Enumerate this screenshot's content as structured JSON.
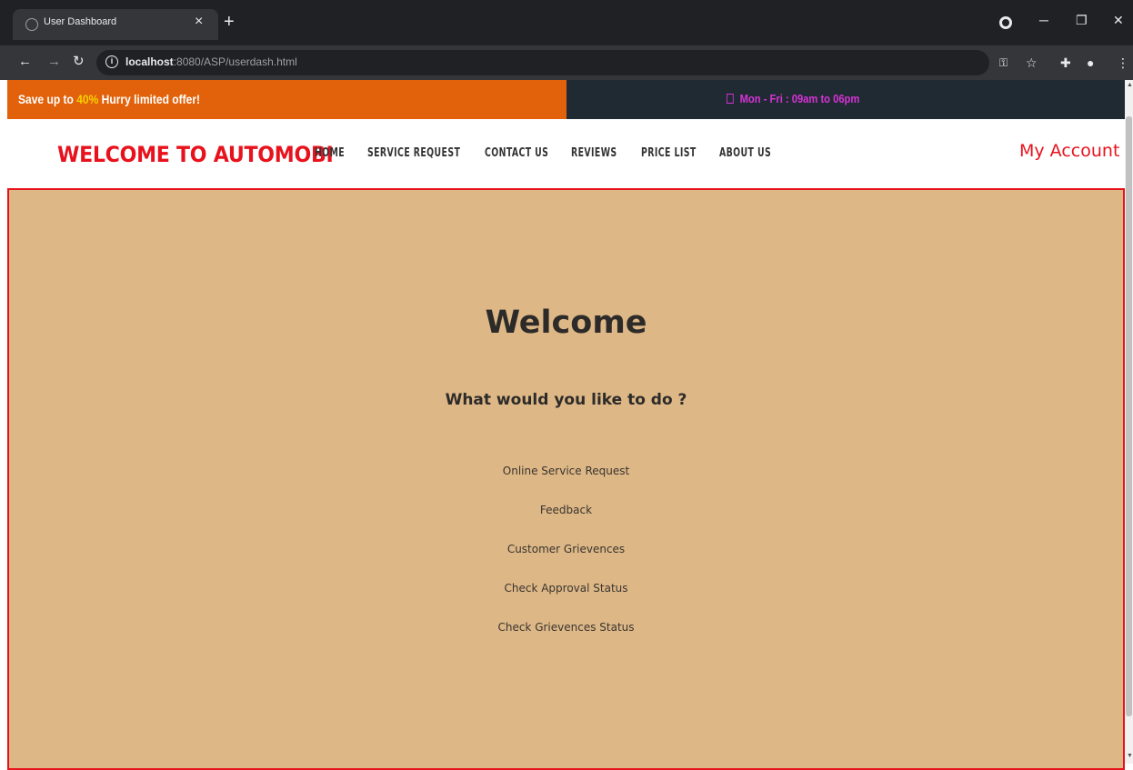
{
  "browser": {
    "tab_title": "User Dashboard",
    "tab_close": "×",
    "new_tab": "+",
    "url_host": "localhost",
    "url_path": ":8080/ASP/userdash.html",
    "icons": [
      "back-icon",
      "forward-icon",
      "reload-icon",
      "info-icon",
      "key-icon",
      "star-icon",
      "extensions-icon",
      "profile-icon",
      "menu-icon",
      "minimize-icon",
      "restore-icon",
      "close-icon"
    ]
  },
  "topbar": {
    "offer_prefix": "Save up to ",
    "offer_highlight": "40%",
    "offer_suffix": " Hurry limited offer!",
    "hours": "Mon - Fri : 09am to 06pm",
    "offer_color": "#e2620b",
    "hours_color": "#d633d6"
  },
  "navbar": {
    "brand": "WELCOME TO AUTOMOBI",
    "links": [
      "HOME",
      "SERVICE REQUEST",
      "CONTACT US",
      "REVIEWS",
      "PRICE LIST",
      "ABOUT US"
    ],
    "account": "My Account",
    "brand_color": "#e8121d"
  },
  "main": {
    "heading": "Welcome",
    "question": "What would you like to do ?",
    "options": [
      "Online Service Request",
      "Feedback",
      "Customer Grievences",
      "Check Approval Status",
      "Check Grievences Status"
    ],
    "background": "#ddb786"
  }
}
